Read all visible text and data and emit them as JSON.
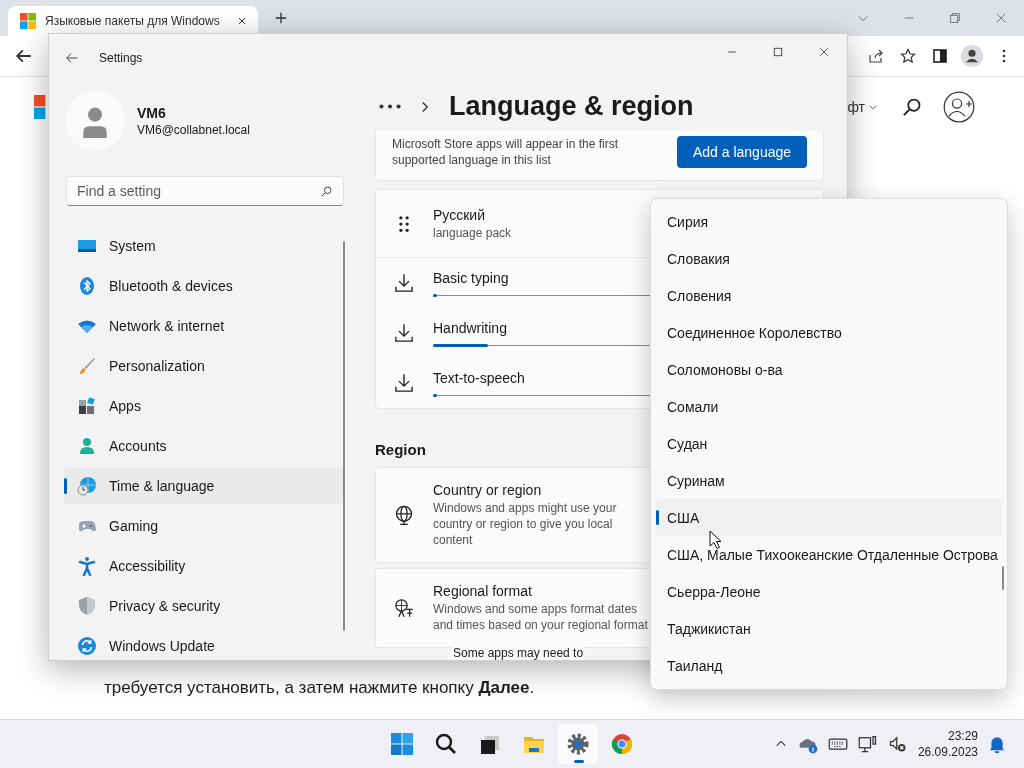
{
  "browser": {
    "tab_title": "Языковые пакеты для Windows",
    "page": {
      "menu_text": "фт",
      "step_text": "требуется установить, а затем нажмите кнопку **Далее**."
    }
  },
  "settings": {
    "title": "Settings",
    "user": {
      "name": "VM6",
      "email": "VM6@collabnet.local"
    },
    "search": {
      "placeholder": "Find a setting"
    },
    "nav": [
      {
        "label": "System",
        "selected": false
      },
      {
        "label": "Bluetooth & devices",
        "selected": false
      },
      {
        "label": "Network & internet",
        "selected": false
      },
      {
        "label": "Personalization",
        "selected": false
      },
      {
        "label": "Apps",
        "selected": false
      },
      {
        "label": "Accounts",
        "selected": false
      },
      {
        "label": "Time & language",
        "selected": true
      },
      {
        "label": "Gaming",
        "selected": false
      },
      {
        "label": "Accessibility",
        "selected": false
      },
      {
        "label": "Privacy & security",
        "selected": false
      },
      {
        "label": "Windows Update",
        "selected": false
      }
    ],
    "page_title": "Language & region",
    "store_note": "Microsoft Store apps will appear in the first supported language in this list",
    "add_button": "Add a language",
    "language": {
      "name": "Русский",
      "subtitle": "language pack"
    },
    "downloads": [
      {
        "label": "Basic typing",
        "level": 0.01
      },
      {
        "label": "Handwriting",
        "level": 0.15
      },
      {
        "label": "Text-to-speech",
        "level": 0.01
      }
    ],
    "region_heading": "Region",
    "region_cards": [
      {
        "kind": "country",
        "title": "Country or region",
        "description": "Windows and apps might use your country or region to give you local content"
      },
      {
        "kind": "format",
        "title": "Regional format",
        "description": "Windows and some apps format dates and times based on your regional format"
      }
    ],
    "tooltip": "Some apps may need to"
  },
  "dropdown": {
    "items": [
      {
        "label": "Сирия",
        "selected": false
      },
      {
        "label": "Словакия",
        "selected": false
      },
      {
        "label": "Словения",
        "selected": false
      },
      {
        "label": "Соединенное Королевство",
        "selected": false
      },
      {
        "label": "Соломоновы о-ва",
        "selected": false
      },
      {
        "label": "Сомали",
        "selected": false
      },
      {
        "label": "Судан",
        "selected": false
      },
      {
        "label": "Суринам",
        "selected": false
      },
      {
        "label": "США",
        "selected": true
      },
      {
        "label": "США, Малые Тихоокеанские Отдаленные Острова",
        "selected": false
      },
      {
        "label": "Сьерра-Леоне",
        "selected": false
      },
      {
        "label": "Таджикистан",
        "selected": false
      },
      {
        "label": "Таиланд",
        "selected": false
      }
    ]
  },
  "taskbar": {
    "apps": [
      {
        "active": false
      },
      {
        "active": false
      },
      {
        "active": false
      },
      {
        "active": false
      },
      {
        "active": true
      },
      {
        "active": false
      }
    ],
    "time": "23:29",
    "date": "26.09.2023"
  }
}
